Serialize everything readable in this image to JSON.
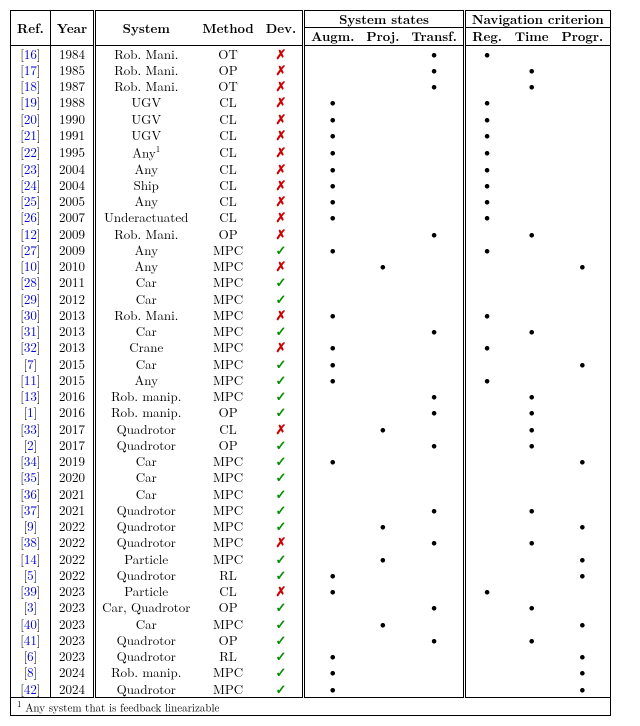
{
  "header": {
    "ref": "Ref.",
    "year": "Year",
    "system": "System",
    "method": "Method",
    "dev": "Dev.",
    "states_group": "System states",
    "augm": "Augm.",
    "proj": "Proj.",
    "transf": "Transf.",
    "nav_group": "Navigation criterion",
    "reg": "Reg.",
    "time": "Time",
    "progr": "Progr."
  },
  "footnote_marker": "1",
  "footnote_text": "Any system that is feedback linearizable",
  "marks": {
    "check": "✓",
    "cross": "✗",
    "dot": "•"
  },
  "rows": [
    {
      "ref": "16",
      "year": "1984",
      "system": "Rob. Mani.",
      "method": "OT",
      "dev": "x",
      "augm": "",
      "proj": "",
      "transf": "d",
      "reg": "d",
      "time": "",
      "progr": ""
    },
    {
      "ref": "17",
      "year": "1985",
      "system": "Rob. Mani.",
      "method": "OP",
      "dev": "x",
      "augm": "",
      "proj": "",
      "transf": "d",
      "reg": "",
      "time": "d",
      "progr": ""
    },
    {
      "ref": "18",
      "year": "1987",
      "system": "Rob. Mani.",
      "method": "OT",
      "dev": "x",
      "augm": "",
      "proj": "",
      "transf": "d",
      "reg": "",
      "time": "d",
      "progr": ""
    },
    {
      "ref": "19",
      "year": "1988",
      "system": "UGV",
      "method": "CL",
      "dev": "x",
      "augm": "d",
      "proj": "",
      "transf": "",
      "reg": "d",
      "time": "",
      "progr": ""
    },
    {
      "ref": "20",
      "year": "1990",
      "system": "UGV",
      "method": "CL",
      "dev": "x",
      "augm": "d",
      "proj": "",
      "transf": "",
      "reg": "d",
      "time": "",
      "progr": ""
    },
    {
      "ref": "21",
      "year": "1991",
      "system": "UGV",
      "method": "CL",
      "dev": "x",
      "augm": "d",
      "proj": "",
      "transf": "",
      "reg": "d",
      "time": "",
      "progr": ""
    },
    {
      "ref": "22",
      "year": "1995",
      "system": "Any",
      "sup": "1",
      "method": "CL",
      "dev": "x",
      "augm": "d",
      "proj": "",
      "transf": "",
      "reg": "d",
      "time": "",
      "progr": ""
    },
    {
      "ref": "23",
      "year": "2004",
      "system": "Any",
      "method": "CL",
      "dev": "x",
      "augm": "d",
      "proj": "",
      "transf": "",
      "reg": "d",
      "time": "",
      "progr": ""
    },
    {
      "ref": "24",
      "year": "2004",
      "system": "Ship",
      "method": "CL",
      "dev": "x",
      "augm": "d",
      "proj": "",
      "transf": "",
      "reg": "d",
      "time": "",
      "progr": ""
    },
    {
      "ref": "25",
      "year": "2005",
      "system": "Any",
      "method": "CL",
      "dev": "x",
      "augm": "d",
      "proj": "",
      "transf": "",
      "reg": "d",
      "time": "",
      "progr": ""
    },
    {
      "ref": "26",
      "year": "2007",
      "system": "Underactuated",
      "method": "CL",
      "dev": "x",
      "augm": "d",
      "proj": "",
      "transf": "",
      "reg": "d",
      "time": "",
      "progr": ""
    },
    {
      "ref": "12",
      "year": "2009",
      "system": "Rob. Mani.",
      "method": "OP",
      "dev": "x",
      "augm": "",
      "proj": "",
      "transf": "d",
      "reg": "",
      "time": "d",
      "progr": ""
    },
    {
      "ref": "27",
      "year": "2009",
      "system": "Any",
      "method": "MPC",
      "dev": "c",
      "augm": "d",
      "proj": "",
      "transf": "",
      "reg": "d",
      "time": "",
      "progr": ""
    },
    {
      "ref": "10",
      "year": "2010",
      "system": "Any",
      "method": "MPC",
      "dev": "x",
      "augm": "",
      "proj": "d",
      "transf": "",
      "reg": "",
      "time": "",
      "progr": "d"
    },
    {
      "ref": "28",
      "year": "2011",
      "system": "Car",
      "method": "MPC",
      "dev": "c",
      "augm": "",
      "proj": "",
      "transf": "",
      "reg": "",
      "time": "",
      "progr": ""
    },
    {
      "ref": "29",
      "year": "2012",
      "system": "Car",
      "method": "MPC",
      "dev": "c",
      "augm": "",
      "proj": "",
      "transf": "",
      "reg": "",
      "time": "",
      "progr": ""
    },
    {
      "ref": "30",
      "year": "2013",
      "system": "Rob. Mani.",
      "method": "MPC",
      "dev": "x",
      "augm": "d",
      "proj": "",
      "transf": "",
      "reg": "d",
      "time": "",
      "progr": ""
    },
    {
      "ref": "31",
      "year": "2013",
      "system": "Car",
      "method": "MPC",
      "dev": "c",
      "augm": "",
      "proj": "",
      "transf": "d",
      "reg": "",
      "time": "d",
      "progr": ""
    },
    {
      "ref": "32",
      "year": "2013",
      "system": "Crane",
      "method": "MPC",
      "dev": "x",
      "augm": "d",
      "proj": "",
      "transf": "",
      "reg": "d",
      "time": "",
      "progr": ""
    },
    {
      "ref": "7",
      "year": "2015",
      "system": "Car",
      "method": "MPC",
      "dev": "c",
      "augm": "d",
      "proj": "",
      "transf": "",
      "reg": "",
      "time": "",
      "progr": "d"
    },
    {
      "ref": "11",
      "year": "2015",
      "system": "Any",
      "method": "MPC",
      "dev": "c",
      "augm": "d",
      "proj": "",
      "transf": "",
      "reg": "d",
      "time": "",
      "progr": ""
    },
    {
      "ref": "13",
      "year": "2016",
      "system": "Rob. manip.",
      "method": "MPC",
      "dev": "c",
      "augm": "",
      "proj": "",
      "transf": "d",
      "reg": "",
      "time": "d",
      "progr": ""
    },
    {
      "ref": "1",
      "year": "2016",
      "system": "Rob. manip.",
      "method": "OP",
      "dev": "c",
      "augm": "",
      "proj": "",
      "transf": "d",
      "reg": "",
      "time": "d",
      "progr": ""
    },
    {
      "ref": "33",
      "year": "2017",
      "system": "Quadrotor",
      "method": "CL",
      "dev": "x",
      "augm": "",
      "proj": "d",
      "transf": "",
      "reg": "",
      "time": "d",
      "progr": ""
    },
    {
      "ref": "2",
      "year": "2017",
      "system": "Quadrotor",
      "method": "OP",
      "dev": "c",
      "augm": "",
      "proj": "",
      "transf": "d",
      "reg": "",
      "time": "d",
      "progr": ""
    },
    {
      "ref": "34",
      "year": "2019",
      "system": "Car",
      "method": "MPC",
      "dev": "c",
      "augm": "d",
      "proj": "",
      "transf": "",
      "reg": "",
      "time": "",
      "progr": "d"
    },
    {
      "ref": "35",
      "year": "2020",
      "system": "Car",
      "method": "MPC",
      "dev": "c",
      "augm": "",
      "proj": "",
      "transf": "",
      "reg": "",
      "time": "",
      "progr": ""
    },
    {
      "ref": "36",
      "year": "2021",
      "system": "Car",
      "method": "MPC",
      "dev": "c",
      "augm": "",
      "proj": "",
      "transf": "",
      "reg": "",
      "time": "",
      "progr": ""
    },
    {
      "ref": "37",
      "year": "2021",
      "system": "Quadrotor",
      "method": "MPC",
      "dev": "c",
      "augm": "",
      "proj": "",
      "transf": "d",
      "reg": "",
      "time": "d",
      "progr": ""
    },
    {
      "ref": "9",
      "year": "2022",
      "system": "Quadrotor",
      "method": "MPC",
      "dev": "c",
      "augm": "",
      "proj": "d",
      "transf": "",
      "reg": "",
      "time": "",
      "progr": "d"
    },
    {
      "ref": "38",
      "year": "2022",
      "system": "Quadrotor",
      "method": "MPC",
      "dev": "x",
      "augm": "",
      "proj": "",
      "transf": "d",
      "reg": "",
      "time": "d",
      "progr": ""
    },
    {
      "ref": "14",
      "year": "2022",
      "system": "Particle",
      "method": "MPC",
      "dev": "c",
      "augm": "",
      "proj": "d",
      "transf": "",
      "reg": "",
      "time": "",
      "progr": "d"
    },
    {
      "ref": "5",
      "year": "2022",
      "system": "Quadrotor",
      "method": "RL",
      "dev": "c",
      "augm": "d",
      "proj": "",
      "transf": "",
      "reg": "",
      "time": "",
      "progr": "d"
    },
    {
      "ref": "39",
      "year": "2023",
      "system": "Particle",
      "method": "CL",
      "dev": "x",
      "augm": "d",
      "proj": "",
      "transf": "",
      "reg": "d",
      "time": "",
      "progr": ""
    },
    {
      "ref": "3",
      "year": "2023",
      "system": "Car, Quadrotor",
      "method": "OP",
      "dev": "c",
      "augm": "",
      "proj": "",
      "transf": "d",
      "reg": "",
      "time": "d",
      "progr": ""
    },
    {
      "ref": "40",
      "year": "2023",
      "system": "Car",
      "method": "MPC",
      "dev": "c",
      "augm": "",
      "proj": "d",
      "transf": "",
      "reg": "",
      "time": "",
      "progr": "d"
    },
    {
      "ref": "41",
      "year": "2023",
      "system": "Quadrotor",
      "method": "OP",
      "dev": "c",
      "augm": "",
      "proj": "",
      "transf": "d",
      "reg": "",
      "time": "d",
      "progr": ""
    },
    {
      "ref": "6",
      "year": "2023",
      "system": "Quadrotor",
      "method": "RL",
      "dev": "c",
      "augm": "d",
      "proj": "",
      "transf": "",
      "reg": "",
      "time": "",
      "progr": "d"
    },
    {
      "ref": "8",
      "year": "2024",
      "system": "Rob. manip.",
      "method": "MPC",
      "dev": "c",
      "augm": "d",
      "proj": "",
      "transf": "",
      "reg": "",
      "time": "",
      "progr": "d"
    },
    {
      "ref": "42",
      "year": "2024",
      "system": "Quadrotor",
      "method": "MPC",
      "dev": "c",
      "augm": "d",
      "proj": "",
      "transf": "",
      "reg": "",
      "time": "",
      "progr": "d"
    }
  ]
}
